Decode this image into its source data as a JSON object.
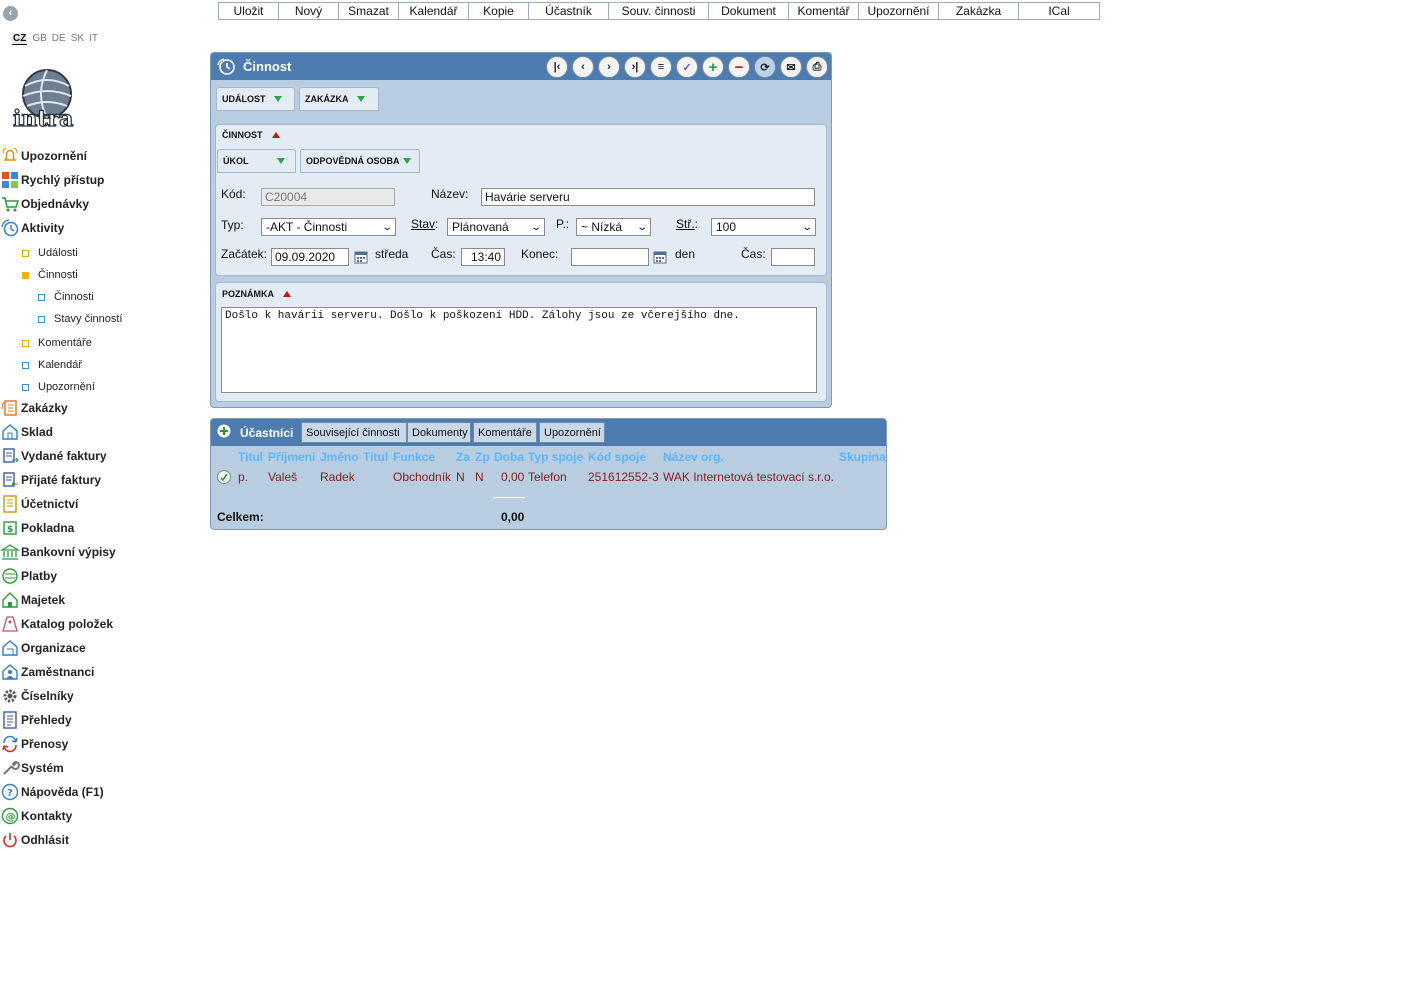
{
  "toolbar": [
    {
      "label": "Uložit",
      "w": 60
    },
    {
      "label": "Nový",
      "w": 60
    },
    {
      "label": "Smazat",
      "w": 60
    },
    {
      "label": "Kalendář",
      "w": 70
    },
    {
      "label": "Kopie",
      "w": 60
    },
    {
      "label": "Účastník",
      "w": 80
    },
    {
      "label": "Souv. činnosti",
      "w": 100
    },
    {
      "label": "Dokument",
      "w": 80
    },
    {
      "label": "Komentář",
      "w": 70
    },
    {
      "label": "Upozornění",
      "w": 80
    },
    {
      "label": "Zakázka",
      "w": 80
    },
    {
      "label": "ICal",
      "w": 80
    }
  ],
  "langs": [
    "CZ",
    "GB",
    "DE",
    "SK",
    "IT"
  ],
  "logo_text": "intra",
  "nav": [
    {
      "label": "Upozornění",
      "icon": "bell-icon"
    },
    {
      "label": "Rychlý přístup",
      "icon": "grid-icon"
    },
    {
      "label": "Objednávky",
      "icon": "cart-icon"
    },
    {
      "label": "Aktivity",
      "icon": "clock-icon"
    },
    {
      "label": "Zakázky",
      "icon": "orders-icon"
    },
    {
      "label": "Sklad",
      "icon": "warehouse-icon"
    },
    {
      "label": "Vydané faktury",
      "icon": "invoice-out-icon"
    },
    {
      "label": "Přijaté faktury",
      "icon": "invoice-in-icon"
    },
    {
      "label": "Účetnictví",
      "icon": "ledger-icon"
    },
    {
      "label": "Pokladna",
      "icon": "cash-icon"
    },
    {
      "label": "Bankovní výpisy",
      "icon": "bank-icon"
    },
    {
      "label": "Platby",
      "icon": "payment-icon"
    },
    {
      "label": "Majetek",
      "icon": "property-icon"
    },
    {
      "label": "Katalog položek",
      "icon": "catalog-icon"
    },
    {
      "label": "Organizace",
      "icon": "organization-icon"
    },
    {
      "label": "Zaměstnanci",
      "icon": "employees-icon"
    },
    {
      "label": "Číselníky",
      "icon": "gear-icon"
    },
    {
      "label": "Přehledy",
      "icon": "report-icon"
    },
    {
      "label": "Přenosy",
      "icon": "sync-icon"
    },
    {
      "label": "Systém",
      "icon": "wrench-icon"
    },
    {
      "label": "Nápověda (F1)",
      "icon": "help-icon"
    },
    {
      "label": "Kontakty",
      "icon": "at-icon"
    },
    {
      "label": "Odhlásit",
      "icon": "power-icon"
    }
  ],
  "subnav": [
    {
      "label": "Události"
    },
    {
      "label": "Činnosti"
    },
    {
      "label": "Činnosti"
    },
    {
      "label": "Stavy činností"
    },
    {
      "label": "Komentáře"
    },
    {
      "label": "Kalendář"
    },
    {
      "label": "Upozornění"
    }
  ],
  "panel": {
    "title": "Činnost",
    "tabs": {
      "event": "UDÁLOST",
      "order": "ZAKÁZKA",
      "activity": "ČINNOST",
      "task": "ÚKOL",
      "responsible": "ODPOVĚDNÁ OSOBA",
      "note": "POZNÁMKA"
    },
    "labels": {
      "code": "Kód:",
      "name": "Název:",
      "type": "Typ:",
      "state": "Stav",
      "priority": "P.:",
      "center": "Stř.",
      "start": "Začátek:",
      "time": "Čas:",
      "end": "Konec:",
      "time2": "Čas:"
    },
    "values": {
      "code": "C20004",
      "name": "Havárie serveru",
      "type": "-AKT - Činnosti",
      "state": "Plánovaná",
      "priority": "~ Nízká",
      "center": "100",
      "start": "09.09.2020",
      "start_day": "středa",
      "start_time": "13:40",
      "end": "",
      "end_day": "den",
      "end_time": ""
    },
    "note": "Došlo k havárii serveru. Došlo k poškození HDD. Zálohy jsou ze včerejšího dne."
  },
  "bottom": {
    "tabs": [
      "Účastníci",
      "Související činnosti",
      "Dokumenty",
      "Komentáře",
      "Upozornění"
    ],
    "headers": [
      "Titul",
      "Příjmení",
      "Jméno",
      "Titul",
      "Funkce",
      "Za",
      "Zp",
      "Doba",
      "Typ spoje",
      "Kód spoje",
      "Název org.",
      "Skupina"
    ],
    "row": {
      "title": "p.",
      "surname": "Valeš",
      "firstname": "Radek",
      "title2": "",
      "function": "Obchodník",
      "za": "N",
      "zp": "N",
      "duration": "0,00",
      "conn_type": "Telefon",
      "conn_code": "251612552-3",
      "org": "WAK Internetová testovací s.r.o.",
      "group": ""
    },
    "total_label": "Celkem:",
    "total_value": "0,00"
  }
}
